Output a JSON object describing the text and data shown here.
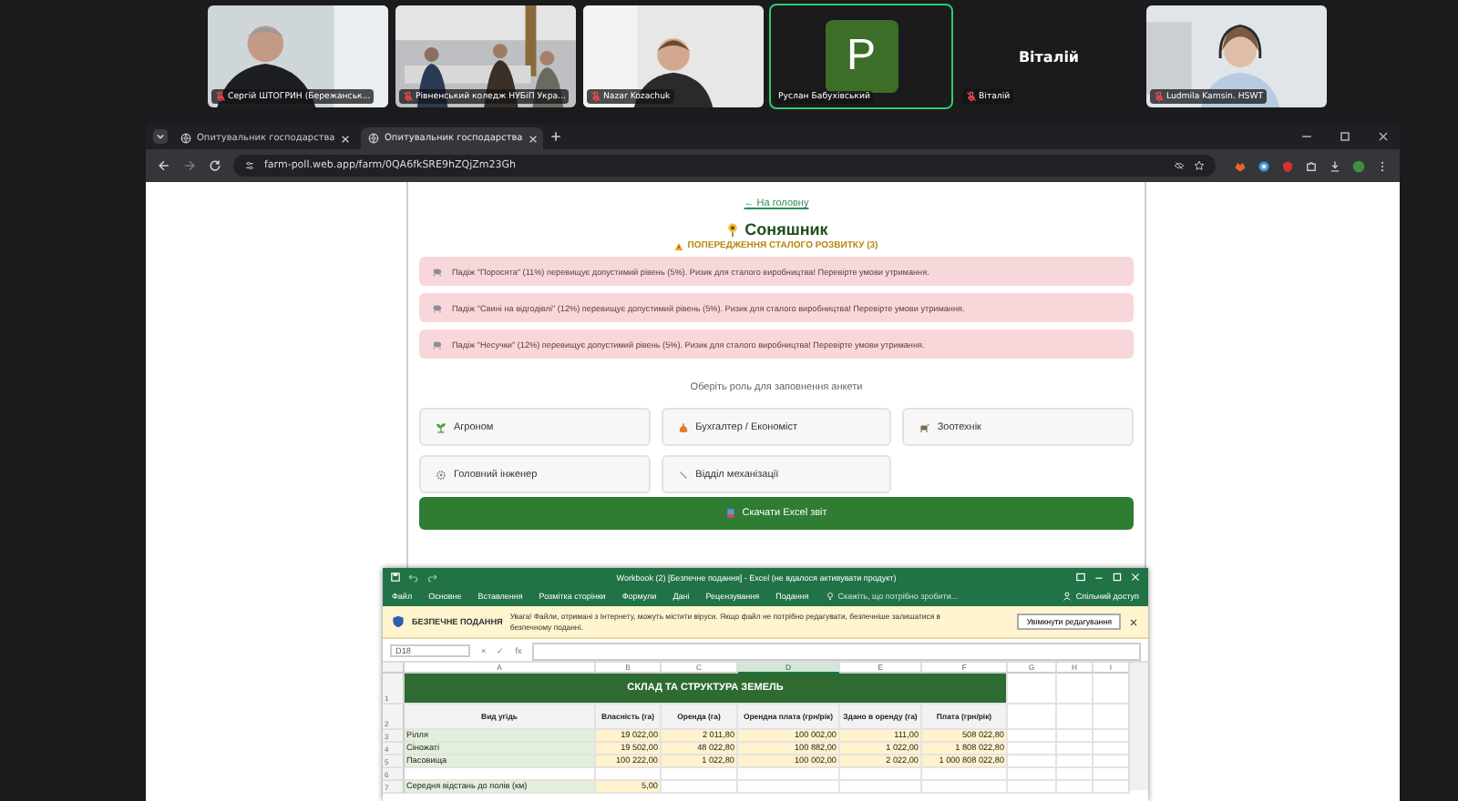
{
  "meeting": {
    "tiles": [
      {
        "kind": "video",
        "name": "Сергій ШТОГРИН (Бережанськ...",
        "muted": true,
        "speaking": false
      },
      {
        "kind": "video",
        "name": "Рівненський коледж НУБіП Укра...",
        "muted": true,
        "speaking": false
      },
      {
        "kind": "video",
        "name": "Nazar Kozachuk",
        "muted": true,
        "speaking": false
      },
      {
        "kind": "avatar",
        "initial": "P",
        "name": "Руслан Бабухівський",
        "muted": false,
        "speaking": true
      },
      {
        "kind": "name",
        "display": "Віталій",
        "name": "Віталій",
        "muted": true,
        "speaking": false
      },
      {
        "kind": "video",
        "name": "Ludmila Kamsin. HSWT",
        "muted": true,
        "speaking": false
      }
    ]
  },
  "browser": {
    "tabs": [
      {
        "title": "Опитувальник господарства",
        "selected": false
      },
      {
        "title": "Опитувальник господарства",
        "selected": true
      }
    ],
    "url": "farm-poll.web.app/farm/0QA6fkSRE9hZQjZm23Gh"
  },
  "page": {
    "back_link": "← На головну",
    "title": "Соняшник",
    "warnings_heading": "ПОПЕРЕДЖЕННЯ СТАЛОГО РОЗВИТКУ (3)",
    "warnings": [
      "Падіж \"Поросята\" (11%) перевищує допустимий рівень (5%). Ризик для сталого виробництва! Перевірте умови утримання.",
      "Падіж \"Свині на відгодівлі\" (12%) перевищує допустимий рівень (5%). Ризик для сталого виробництва! Перевірте умови утримання.",
      "Падіж \"Несучки\" (12%) перевищує допустимий рівень (5%). Ризик для сталого виробництва! Перевірте умови утримання."
    ],
    "prompt": "Оберіть роль для заповнення анкети",
    "roles": [
      "Агроном",
      "Бухгалтер / Економіст",
      "Зоотехнік",
      "Головний інженер",
      "Відділ механізації"
    ],
    "download": "Скачати Excel звіт"
  },
  "excel": {
    "title": "Workbook (2) [Безпечне подання] - Excel (не вдалося активувати продукт)",
    "menu": [
      "Файл",
      "Основне",
      "Вставлення",
      "Розмітка сторінки",
      "Формули",
      "Дані",
      "Рецензування",
      "Подання"
    ],
    "tell_me": "Скажіть, що потрібно зробити...",
    "share": "Спільний доступ",
    "protected_view": {
      "label": "БЕЗПЕЧНЕ ПОДАННЯ",
      "message": "Увага! Файли, отримані з Інтернету, можуть містити віруси. Якщо файл не потрібно редагувати, безпечніше залишатися в безпечному поданні.",
      "button": "Увімкнути редагування"
    },
    "name_box": "D18",
    "formula_buttons": [
      "×",
      "✓",
      "fx"
    ],
    "columns": [
      {
        "label": "A",
        "selected": false
      },
      {
        "label": "B",
        "selected": false
      },
      {
        "label": "C",
        "selected": false
      },
      {
        "label": "D",
        "selected": true
      },
      {
        "label": "E",
        "selected": false
      },
      {
        "label": "F",
        "selected": false
      },
      {
        "label": "G",
        "selected": false
      },
      {
        "label": "H",
        "selected": false
      },
      {
        "label": "I",
        "selected": false
      }
    ],
    "rows": [
      {
        "number": "1",
        "kind": "title",
        "cells": [
          "СКЛАД ТА СТРУКТУРА ЗЕМЕЛЬ"
        ]
      },
      {
        "number": "2",
        "kind": "header",
        "cells": [
          "Вид угідь",
          "Власність (га)",
          "Оренда (га)",
          "Орендна плата (грн/рік)",
          "Здано в оренду (га)",
          "Плата (грн/рік)"
        ]
      },
      {
        "number": "3",
        "kind": "data",
        "cells": [
          "Рілля",
          "19 022,00",
          "2 011,80",
          "100 002,00",
          "111,00",
          "508 022,80"
        ]
      },
      {
        "number": "4",
        "kind": "data",
        "cells": [
          "Сіножаті",
          "19 502,00",
          "48 022,80",
          "100 882,00",
          "1 022,00",
          "1 808 022,80"
        ]
      },
      {
        "number": "5",
        "kind": "data",
        "cells": [
          "Пасовища",
          "100 222,00",
          "1 022,80",
          "100 002,00",
          "2 022,00",
          "1 000 808 022,80"
        ]
      },
      {
        "number": "6",
        "kind": "empty"
      },
      {
        "number": "7",
        "kind": "data",
        "cells": [
          "Середня відстань до полів (км)",
          "5,00"
        ]
      }
    ]
  }
}
